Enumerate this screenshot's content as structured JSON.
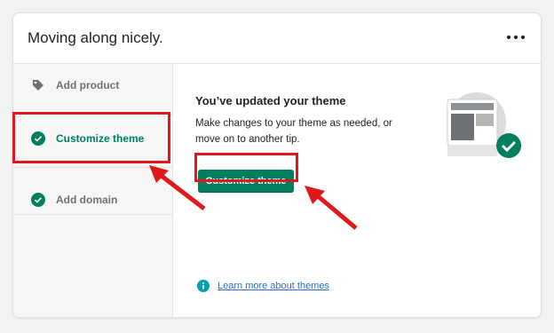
{
  "card": {
    "title": "Moving along nicely.",
    "more_icon": "more-horizontal-icon"
  },
  "sidebar": {
    "items": [
      {
        "label": "Add product",
        "icon": "tag-icon",
        "state": "default"
      },
      {
        "label": "Customize theme",
        "icon": "check-circle-icon",
        "state": "active-complete"
      },
      {
        "label": "Add domain",
        "icon": "check-circle-icon",
        "state": "complete"
      }
    ]
  },
  "main": {
    "title": "You’ve updated your theme",
    "description": "Make changes to your theme as needed, or move on to another tip.",
    "button_label": "Customize theme",
    "learn_link": {
      "label": "Learn more about themes",
      "icon": "info-icon"
    },
    "illustration": "theme-complete-illustration"
  },
  "colors": {
    "accent": "#008060",
    "active_text": "#007f5f",
    "link": "#2c6ecb",
    "annotation": "#e0171d"
  }
}
